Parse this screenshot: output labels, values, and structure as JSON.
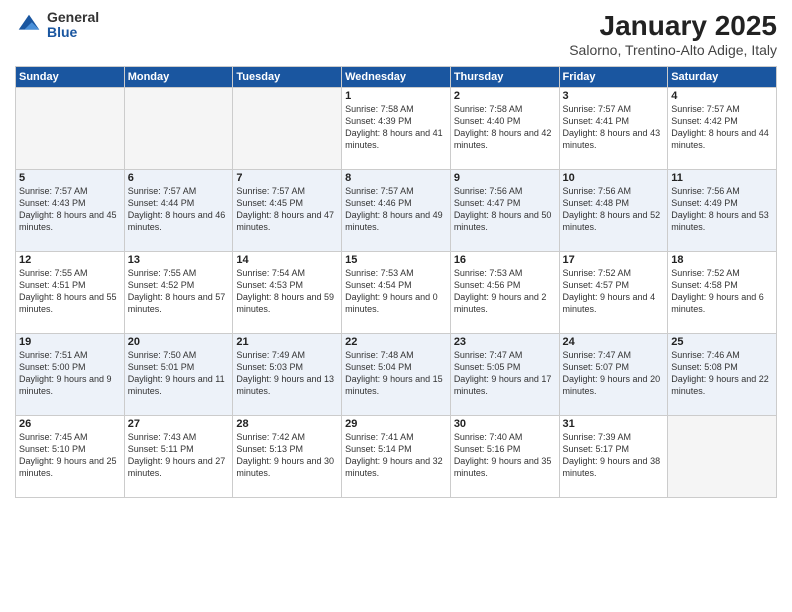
{
  "logo": {
    "general": "General",
    "blue": "Blue"
  },
  "title": "January 2025",
  "location": "Salorno, Trentino-Alto Adige, Italy",
  "weekdays": [
    "Sunday",
    "Monday",
    "Tuesday",
    "Wednesday",
    "Thursday",
    "Friday",
    "Saturday"
  ],
  "weeks": [
    [
      {
        "day": "",
        "text": ""
      },
      {
        "day": "",
        "text": ""
      },
      {
        "day": "",
        "text": ""
      },
      {
        "day": "1",
        "text": "Sunrise: 7:58 AM\nSunset: 4:39 PM\nDaylight: 8 hours and 41 minutes."
      },
      {
        "day": "2",
        "text": "Sunrise: 7:58 AM\nSunset: 4:40 PM\nDaylight: 8 hours and 42 minutes."
      },
      {
        "day": "3",
        "text": "Sunrise: 7:57 AM\nSunset: 4:41 PM\nDaylight: 8 hours and 43 minutes."
      },
      {
        "day": "4",
        "text": "Sunrise: 7:57 AM\nSunset: 4:42 PM\nDaylight: 8 hours and 44 minutes."
      }
    ],
    [
      {
        "day": "5",
        "text": "Sunrise: 7:57 AM\nSunset: 4:43 PM\nDaylight: 8 hours and 45 minutes."
      },
      {
        "day": "6",
        "text": "Sunrise: 7:57 AM\nSunset: 4:44 PM\nDaylight: 8 hours and 46 minutes."
      },
      {
        "day": "7",
        "text": "Sunrise: 7:57 AM\nSunset: 4:45 PM\nDaylight: 8 hours and 47 minutes."
      },
      {
        "day": "8",
        "text": "Sunrise: 7:57 AM\nSunset: 4:46 PM\nDaylight: 8 hours and 49 minutes."
      },
      {
        "day": "9",
        "text": "Sunrise: 7:56 AM\nSunset: 4:47 PM\nDaylight: 8 hours and 50 minutes."
      },
      {
        "day": "10",
        "text": "Sunrise: 7:56 AM\nSunset: 4:48 PM\nDaylight: 8 hours and 52 minutes."
      },
      {
        "day": "11",
        "text": "Sunrise: 7:56 AM\nSunset: 4:49 PM\nDaylight: 8 hours and 53 minutes."
      }
    ],
    [
      {
        "day": "12",
        "text": "Sunrise: 7:55 AM\nSunset: 4:51 PM\nDaylight: 8 hours and 55 minutes."
      },
      {
        "day": "13",
        "text": "Sunrise: 7:55 AM\nSunset: 4:52 PM\nDaylight: 8 hours and 57 minutes."
      },
      {
        "day": "14",
        "text": "Sunrise: 7:54 AM\nSunset: 4:53 PM\nDaylight: 8 hours and 59 minutes."
      },
      {
        "day": "15",
        "text": "Sunrise: 7:53 AM\nSunset: 4:54 PM\nDaylight: 9 hours and 0 minutes."
      },
      {
        "day": "16",
        "text": "Sunrise: 7:53 AM\nSunset: 4:56 PM\nDaylight: 9 hours and 2 minutes."
      },
      {
        "day": "17",
        "text": "Sunrise: 7:52 AM\nSunset: 4:57 PM\nDaylight: 9 hours and 4 minutes."
      },
      {
        "day": "18",
        "text": "Sunrise: 7:52 AM\nSunset: 4:58 PM\nDaylight: 9 hours and 6 minutes."
      }
    ],
    [
      {
        "day": "19",
        "text": "Sunrise: 7:51 AM\nSunset: 5:00 PM\nDaylight: 9 hours and 9 minutes."
      },
      {
        "day": "20",
        "text": "Sunrise: 7:50 AM\nSunset: 5:01 PM\nDaylight: 9 hours and 11 minutes."
      },
      {
        "day": "21",
        "text": "Sunrise: 7:49 AM\nSunset: 5:03 PM\nDaylight: 9 hours and 13 minutes."
      },
      {
        "day": "22",
        "text": "Sunrise: 7:48 AM\nSunset: 5:04 PM\nDaylight: 9 hours and 15 minutes."
      },
      {
        "day": "23",
        "text": "Sunrise: 7:47 AM\nSunset: 5:05 PM\nDaylight: 9 hours and 17 minutes."
      },
      {
        "day": "24",
        "text": "Sunrise: 7:47 AM\nSunset: 5:07 PM\nDaylight: 9 hours and 20 minutes."
      },
      {
        "day": "25",
        "text": "Sunrise: 7:46 AM\nSunset: 5:08 PM\nDaylight: 9 hours and 22 minutes."
      }
    ],
    [
      {
        "day": "26",
        "text": "Sunrise: 7:45 AM\nSunset: 5:10 PM\nDaylight: 9 hours and 25 minutes."
      },
      {
        "day": "27",
        "text": "Sunrise: 7:43 AM\nSunset: 5:11 PM\nDaylight: 9 hours and 27 minutes."
      },
      {
        "day": "28",
        "text": "Sunrise: 7:42 AM\nSunset: 5:13 PM\nDaylight: 9 hours and 30 minutes."
      },
      {
        "day": "29",
        "text": "Sunrise: 7:41 AM\nSunset: 5:14 PM\nDaylight: 9 hours and 32 minutes."
      },
      {
        "day": "30",
        "text": "Sunrise: 7:40 AM\nSunset: 5:16 PM\nDaylight: 9 hours and 35 minutes."
      },
      {
        "day": "31",
        "text": "Sunrise: 7:39 AM\nSunset: 5:17 PM\nDaylight: 9 hours and 38 minutes."
      },
      {
        "day": "",
        "text": ""
      }
    ]
  ]
}
